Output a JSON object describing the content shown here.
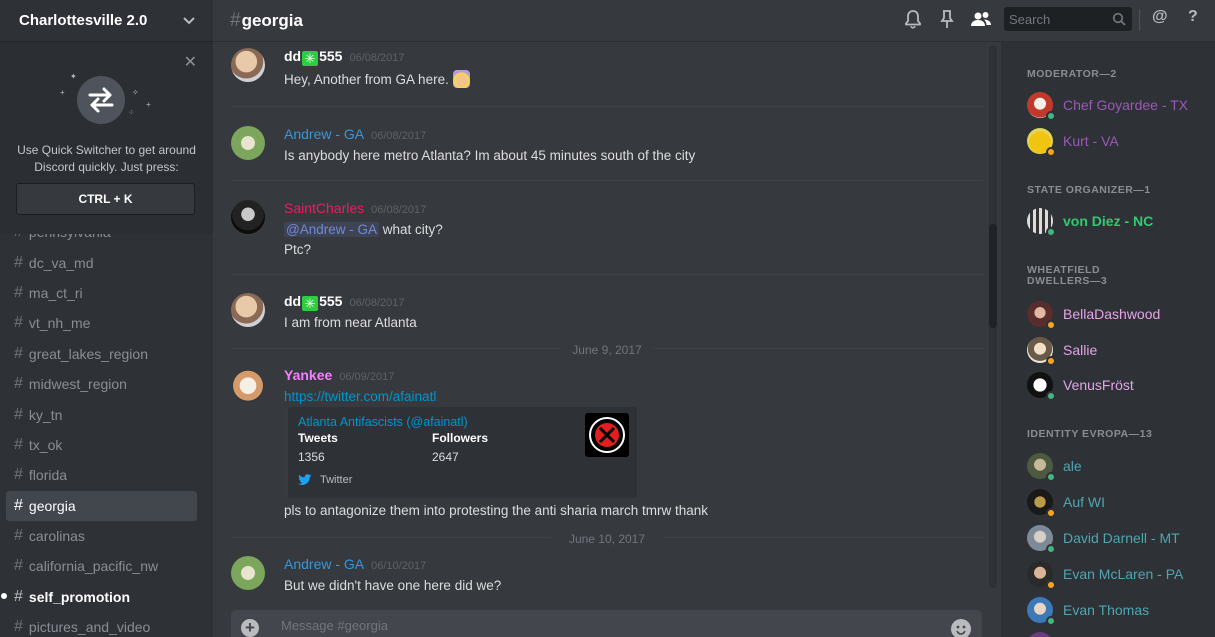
{
  "server": {
    "name": "Charlottesville 2.0"
  },
  "quick_switcher": {
    "text": "Use Quick Switcher to get around Discord quickly. Just press:",
    "shortcut": "CTRL + K"
  },
  "channels": [
    {
      "name": "pennsylvania"
    },
    {
      "name": "dc_va_md"
    },
    {
      "name": "ma_ct_ri"
    },
    {
      "name": "vt_nh_me"
    },
    {
      "name": "great_lakes_region"
    },
    {
      "name": "midwest_region"
    },
    {
      "name": "ky_tn"
    },
    {
      "name": "tx_ok"
    },
    {
      "name": "florida"
    },
    {
      "name": "georgia"
    },
    {
      "name": "carolinas"
    },
    {
      "name": "california_pacific_nw"
    },
    {
      "name": "self_promotion"
    },
    {
      "name": "pictures_and_video"
    }
  ],
  "channel_hash": "#",
  "header": {
    "channel": "georgia",
    "search_placeholder": "Search"
  },
  "messages": {
    "m1": {
      "user_a": "dd",
      "badge": "✳",
      "user_b": "555",
      "time": "06/08/2017",
      "text": "Hey,  Another from GA here."
    },
    "m2": {
      "user": "Andrew - GA",
      "time": "06/08/2017",
      "text": "Is anybody here metro Atlanta? Im about 45 minutes south of the city"
    },
    "m3": {
      "user": "SaintCharles",
      "time": "06/08/2017",
      "mention": "@Andrew - GA",
      "text_a": " what city?",
      "text_b": "Ptc?"
    },
    "m4": {
      "user_a": "dd",
      "badge": "✳",
      "user_b": "555",
      "time": "06/08/2017",
      "text": "I am from near Atlanta"
    },
    "date1": "June 9, 2017",
    "m5": {
      "user": "Yankee",
      "time": "06/09/2017",
      "link": "https://twitter.com/afainatl",
      "embed": {
        "title": "Atlanta Antifascists (@afainatl)",
        "field1_name": "Tweets",
        "field1_value": "1356",
        "field2_name": "Followers",
        "field2_value": "2647",
        "footer": "Twitter"
      },
      "text": "pls to antagonize them into protesting the anti sharia march tmrw thank"
    },
    "date2": "June 10, 2017",
    "m6": {
      "user": "Andrew - GA",
      "time": "06/10/2017",
      "text": "But we didn't have one here did we?"
    }
  },
  "composer": {
    "placeholder": "Message #georgia"
  },
  "members": {
    "roles": [
      {
        "title": "MODERATOR—2",
        "members": [
          "Chef Goyardee - TX",
          "Kurt - VA"
        ]
      },
      {
        "title": "STATE ORGANIZER—1",
        "members": [
          "von Diez - NC"
        ]
      },
      {
        "title": "WHEATFIELD DWELLERS—3",
        "members": [
          "BellaDashwood",
          "Sallie",
          "VenusFröst"
        ]
      },
      {
        "title": "IDENTITY EVROPA—13",
        "members": [
          "ale",
          "Auf WI",
          "David Darnell - MT",
          "Evan McLaren - PA",
          "Evan Thomas"
        ]
      }
    ]
  },
  "colors": {
    "moderator": "#9b59b6",
    "organizer": "#2ecc71",
    "wheatfield": "#e3a4e8",
    "evropa": "#4fa6b2",
    "andrew": "#3498db",
    "saint": "#e91e63",
    "yankee": "#f47fff",
    "online": "#43b581",
    "idle": "#faa61a"
  },
  "icons": [
    "bell-icon",
    "pin-icon",
    "members-icon",
    "search-icon",
    "at-icon",
    "help-icon",
    "chevron-down-icon",
    "close-icon",
    "twitter-icon",
    "add-icon",
    "emoji-icon"
  ]
}
